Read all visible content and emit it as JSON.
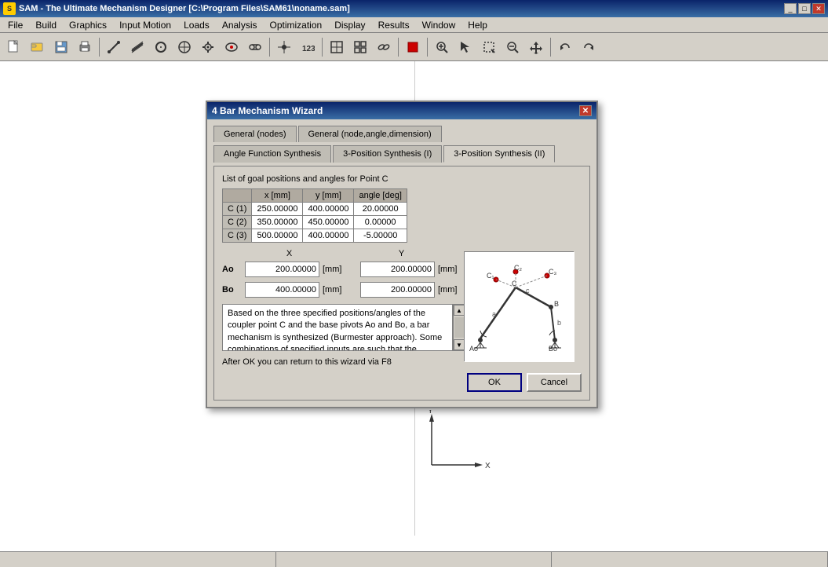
{
  "window": {
    "title": "SAM - The Ultimate Mechanism Designer [C:\\Program Files\\SAM61\\noname.sam]",
    "icon": "S"
  },
  "win_buttons": [
    "_",
    "□",
    "✕"
  ],
  "menu": {
    "items": [
      "File",
      "Build",
      "Graphics",
      "Input Motion",
      "Loads",
      "Analysis",
      "Optimization",
      "Display",
      "Results",
      "Window",
      "Help"
    ]
  },
  "dialog": {
    "title": "4 Bar Mechanism Wizard",
    "tabs_row1": [
      {
        "label": "General (nodes)",
        "active": false
      },
      {
        "label": "General (node,angle,dimension)",
        "active": false
      }
    ],
    "tabs_row2": [
      {
        "label": "Angle Function Synthesis",
        "active": false
      },
      {
        "label": "3-Position Synthesis (I)",
        "active": false
      },
      {
        "label": "3-Position Synthesis (II)",
        "active": true
      }
    ],
    "content": {
      "list_label": "List of goal positions and angles for Point C",
      "table": {
        "headers": [
          "",
          "x [mm]",
          "y [mm]",
          "angle [deg]"
        ],
        "rows": [
          {
            "label": "C (1)",
            "x": "250.00000",
            "y": "400.00000",
            "angle": "20.00000"
          },
          {
            "label": "C (2)",
            "x": "350.00000",
            "y": "450.00000",
            "angle": "0.00000"
          },
          {
            "label": "C (3)",
            "x": "500.00000",
            "y": "400.00000",
            "angle": "-5.00000"
          }
        ]
      },
      "xy_header": {
        "x_label": "X",
        "y_label": "Y"
      },
      "ao_label": "Ao",
      "ao_x_value": "200.00000",
      "ao_x_unit": "[mm]",
      "ao_y_value": "200.00000",
      "ao_y_unit": "[mm]",
      "bo_label": "Bo",
      "bo_x_value": "400.00000",
      "bo_x_unit": "[mm]",
      "bo_y_value": "200.00000",
      "bo_y_unit": "[mm]",
      "description": "Based on the three specified positions/angles of the coupler point C and the base pivots Ao and Bo, a  bar mechanism is synthesized (Burmester approach). Some combinations of specified inputs are such that the resulting mechanism can not reach all positions without being dis-assembled. Also it might be necessary to",
      "bottom_note": "After OK you can return to this wizard via F8",
      "ok_label": "OK",
      "cancel_label": "Cancel"
    }
  },
  "toolbar": {
    "buttons": [
      {
        "name": "new",
        "icon": "📄"
      },
      {
        "name": "open",
        "icon": "📂"
      },
      {
        "name": "save",
        "icon": "💾"
      },
      {
        "name": "print",
        "icon": "🖨"
      },
      {
        "name": "sep1",
        "type": "sep"
      },
      {
        "name": "line",
        "icon": "/"
      },
      {
        "name": "beam",
        "icon": "⟋"
      },
      {
        "name": "circle",
        "icon": "○"
      },
      {
        "name": "gear",
        "icon": "⚙"
      },
      {
        "name": "cam",
        "icon": "◉"
      },
      {
        "name": "belt",
        "icon": "∞"
      },
      {
        "name": "spring",
        "icon": "⌇"
      },
      {
        "name": "sep2",
        "type": "sep"
      },
      {
        "name": "node",
        "icon": "·"
      },
      {
        "name": "number",
        "icon": "123"
      },
      {
        "name": "sep3",
        "type": "sep"
      },
      {
        "name": "frame",
        "icon": "⊞"
      },
      {
        "name": "cross",
        "icon": "✚"
      },
      {
        "name": "chain",
        "icon": "⛓"
      },
      {
        "name": "sep4",
        "type": "sep"
      },
      {
        "name": "stop",
        "icon": "⏹"
      },
      {
        "name": "sep5",
        "type": "sep"
      },
      {
        "name": "zoom-in",
        "icon": "🔍"
      },
      {
        "name": "select",
        "icon": "⬡"
      },
      {
        "name": "zoom-window",
        "icon": "⬜"
      },
      {
        "name": "zoom-out",
        "icon": "🔎"
      },
      {
        "name": "pan",
        "icon": "✋"
      },
      {
        "name": "sep6",
        "type": "sep"
      },
      {
        "name": "undo",
        "icon": "↩"
      },
      {
        "name": "redo",
        "icon": "↪"
      }
    ]
  },
  "statusbar": {
    "cells": [
      "",
      "",
      ""
    ]
  }
}
